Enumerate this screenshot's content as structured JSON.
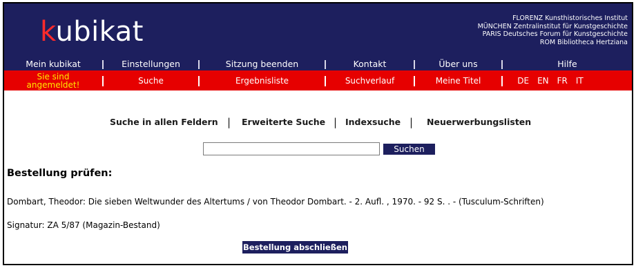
{
  "logo": {
    "first_letter": "k",
    "rest": "ubikat"
  },
  "institutes": [
    "FLORENZ Kunsthistorisches Institut",
    "MÜNCHEN Zentralinstitut für Kunstgeschichte",
    "PARIS Deutsches Forum für Kunstgeschichte",
    "ROM Bibliotheca Hertziana"
  ],
  "nav_top": {
    "mein_kubikat": "Mein kubikat",
    "einstellungen": "Einstellungen",
    "sitzung_beenden": "Sitzung beenden",
    "kontakt": "Kontakt",
    "ueber_uns": "Über uns",
    "hilfe": "Hilfe"
  },
  "nav_bottom": {
    "status_line1": "Sie sind",
    "status_line2": "angemeldet!",
    "suche": "Suche",
    "ergebnisliste": "Ergebnisliste",
    "suchverlauf": "Suchverlauf",
    "meine_titel": "Meine Titel",
    "languages": [
      "DE",
      "EN",
      "FR",
      "IT"
    ]
  },
  "search_links": {
    "alle_felder": "Suche in allen Feldern",
    "erweiterte": "Erweiterte Suche",
    "index": "Indexsuche",
    "neuerwerbung": "Neuerwerbungslisten",
    "separator": "|"
  },
  "search": {
    "value": "",
    "button_label": "Suchen"
  },
  "order": {
    "title": "Bestellung prüfen:",
    "citation": "Dombart, Theodor: Die sieben Weltwunder des Altertums / von Theodor Dombart. - 2. Aufl. , 1970. - 92 S. . - (Tusculum-Schriften)",
    "signatur": "Signatur: ZA 5/87 (Magazin-Bestand)",
    "button_label": "Bestellung abschließen"
  },
  "colors": {
    "navy": "#1d1f5e",
    "red": "#e60000",
    "status_yellow": "#ffe800",
    "logo_red": "#ff2b2b"
  }
}
